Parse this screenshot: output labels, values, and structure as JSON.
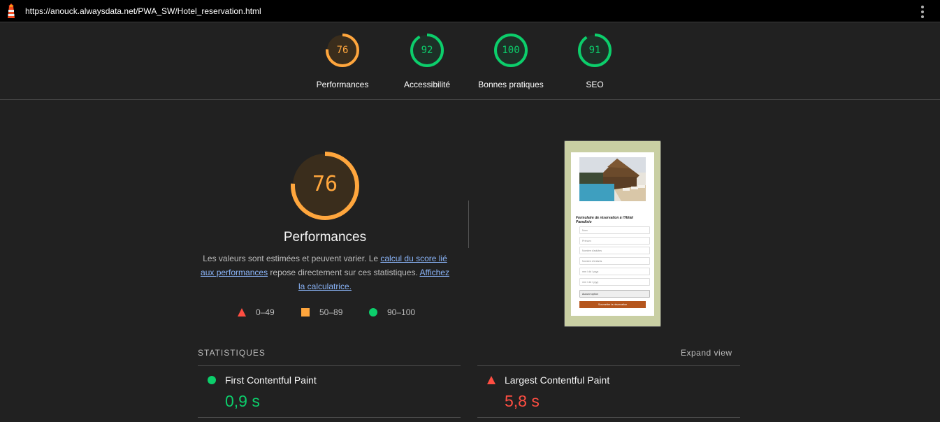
{
  "header": {
    "url": "https://anouck.alwaysdata.net/PWA_SW/Hotel_reservation.html"
  },
  "categories": [
    {
      "label": "Performances",
      "score": 76,
      "color": "#ffa63d",
      "track": "#3a2d1c"
    },
    {
      "label": "Accessibilité",
      "score": 92,
      "color": "#0cce6b",
      "track": "#1d3027"
    },
    {
      "label": "Bonnes pratiques",
      "score": 100,
      "color": "#0cce6b",
      "track": "#1d3027"
    },
    {
      "label": "SEO",
      "score": 91,
      "color": "#0cce6b",
      "track": "#1d3027"
    }
  ],
  "main": {
    "score": 76,
    "title": "Performances",
    "desc_before": "Les valeurs sont estimées et peuvent varier. Le ",
    "link1": "calcul du score lié aux performances",
    "desc_middle": " repose directement sur ces statistiques. ",
    "link2": "Affichez la calculatrice.",
    "legend": {
      "fail": "0–49",
      "average": "50–89",
      "pass": "90–100"
    }
  },
  "thumbnail": {
    "form_title": "Formulaire de réservation à l'Hôtel Paradisio",
    "fields": [
      "Nom",
      "Prénom",
      "Nombre d'adultes",
      "Nombre d'enfants",
      "mm / dd / yyyy",
      "mm / dd / yyyy"
    ],
    "select_value": "Aucune option",
    "submit_label": "Soumettre la réservation"
  },
  "stats": {
    "heading": "STATISTIQUES",
    "expand_label": "Expand view",
    "metrics": [
      {
        "name": "First Contentful Paint",
        "value": "0,9 s",
        "status": "pass",
        "color": "#0cce6b"
      },
      {
        "name": "Largest Contentful Paint",
        "value": "5,8 s",
        "status": "fail",
        "color": "#ff4e42"
      }
    ]
  }
}
